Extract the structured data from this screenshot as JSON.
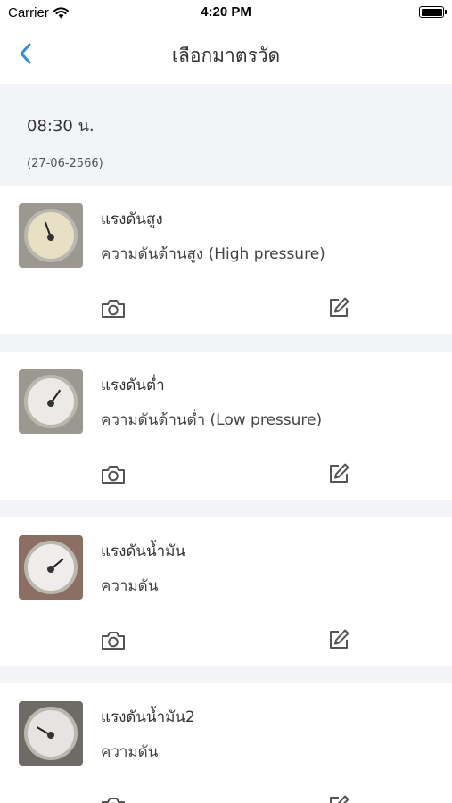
{
  "status_bar": {
    "carrier": "Carrier",
    "time": "4:20 PM"
  },
  "nav": {
    "title": "เลือกมาตรวัด",
    "back_icon": "chevron-left-icon",
    "accent_color": "#2f8fd8"
  },
  "header": {
    "time": "08:30 น.",
    "date": "(27-06-2566)"
  },
  "items": [
    {
      "name": "แรงดันสูง",
      "description": "ความดันด้านสูง (High pressure)"
    },
    {
      "name": "แรงดันต่ำ",
      "description": "ความดันด้านต่ำ (Low pressure)"
    },
    {
      "name": "แรงดันน้ำมัน",
      "description": "ความดัน"
    },
    {
      "name": "แรงดันน้ำมัน2",
      "description": "ความดัน"
    }
  ],
  "colors": {
    "background_gray": "#f2f4f7",
    "icon_gray": "#555555"
  }
}
